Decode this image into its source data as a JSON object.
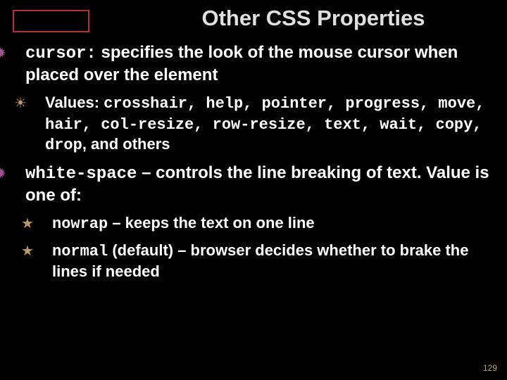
{
  "page_number": "129",
  "title": "Other CSS Properties",
  "items": {
    "cursor": {
      "code": "cursor:",
      "desc_before": " specifies the look of the mouse cursor when placed over the element",
      "values_label": "Values: ",
      "values": "crosshair, help, pointer, progress, move, hair, col-resize, row-resize, text, wait, copy, drop",
      "values_after": ", and others"
    },
    "whitespace": {
      "code": "white-space",
      "desc": " – controls the line breaking of text. Value is one of:",
      "nowrap_code": "nowrap",
      "nowrap_desc": " – keeps the text on one line",
      "normal_code": "normal",
      "normal_desc": " (default) – browser decides whether to brake the lines if needed"
    }
  }
}
